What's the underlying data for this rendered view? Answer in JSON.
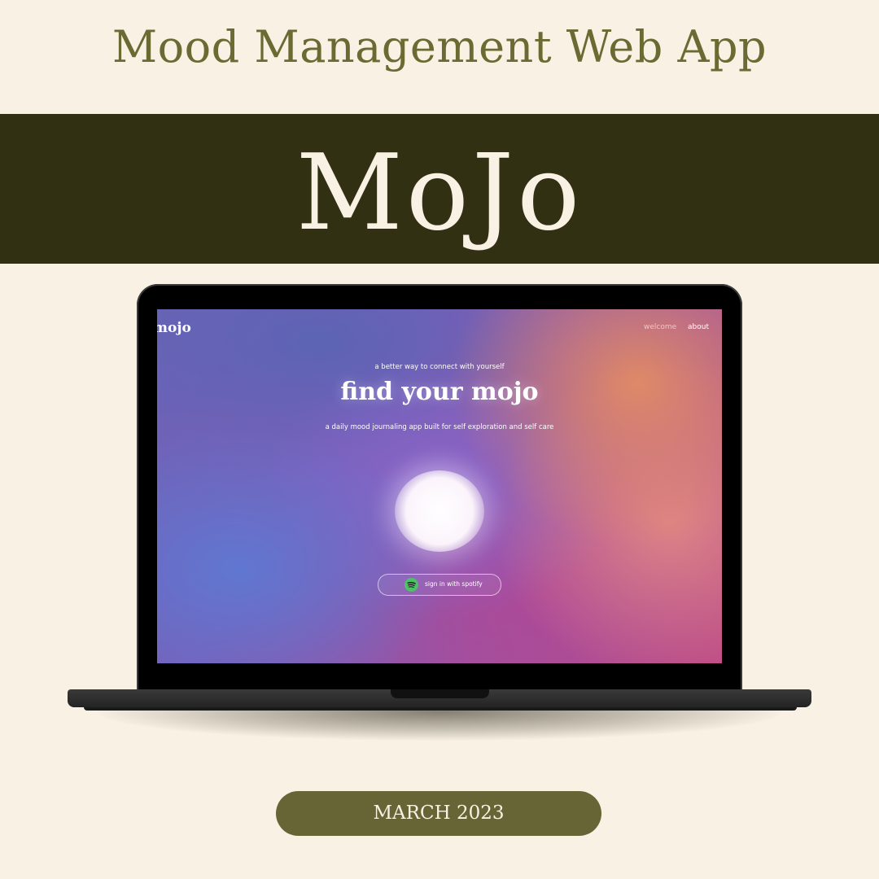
{
  "page": {
    "heading": "Mood Management Web App",
    "brand": "MoJo",
    "date": "MARCH 2023"
  },
  "app": {
    "logo": "mojo",
    "nav": {
      "welcome": "welcome",
      "about": "about"
    },
    "tagline": "a better way to connect with yourself",
    "title": "find your mojo",
    "subtitle": "a daily mood journaling app built for self exploration and self care",
    "signin_button": {
      "label": "sign in with spotify",
      "icon": "spotify-icon"
    }
  },
  "colors": {
    "background": "#f8f1e4",
    "band": "#313012",
    "heading": "#6b6a33",
    "pill": "#676535",
    "spotify": "#4fbf6a"
  }
}
